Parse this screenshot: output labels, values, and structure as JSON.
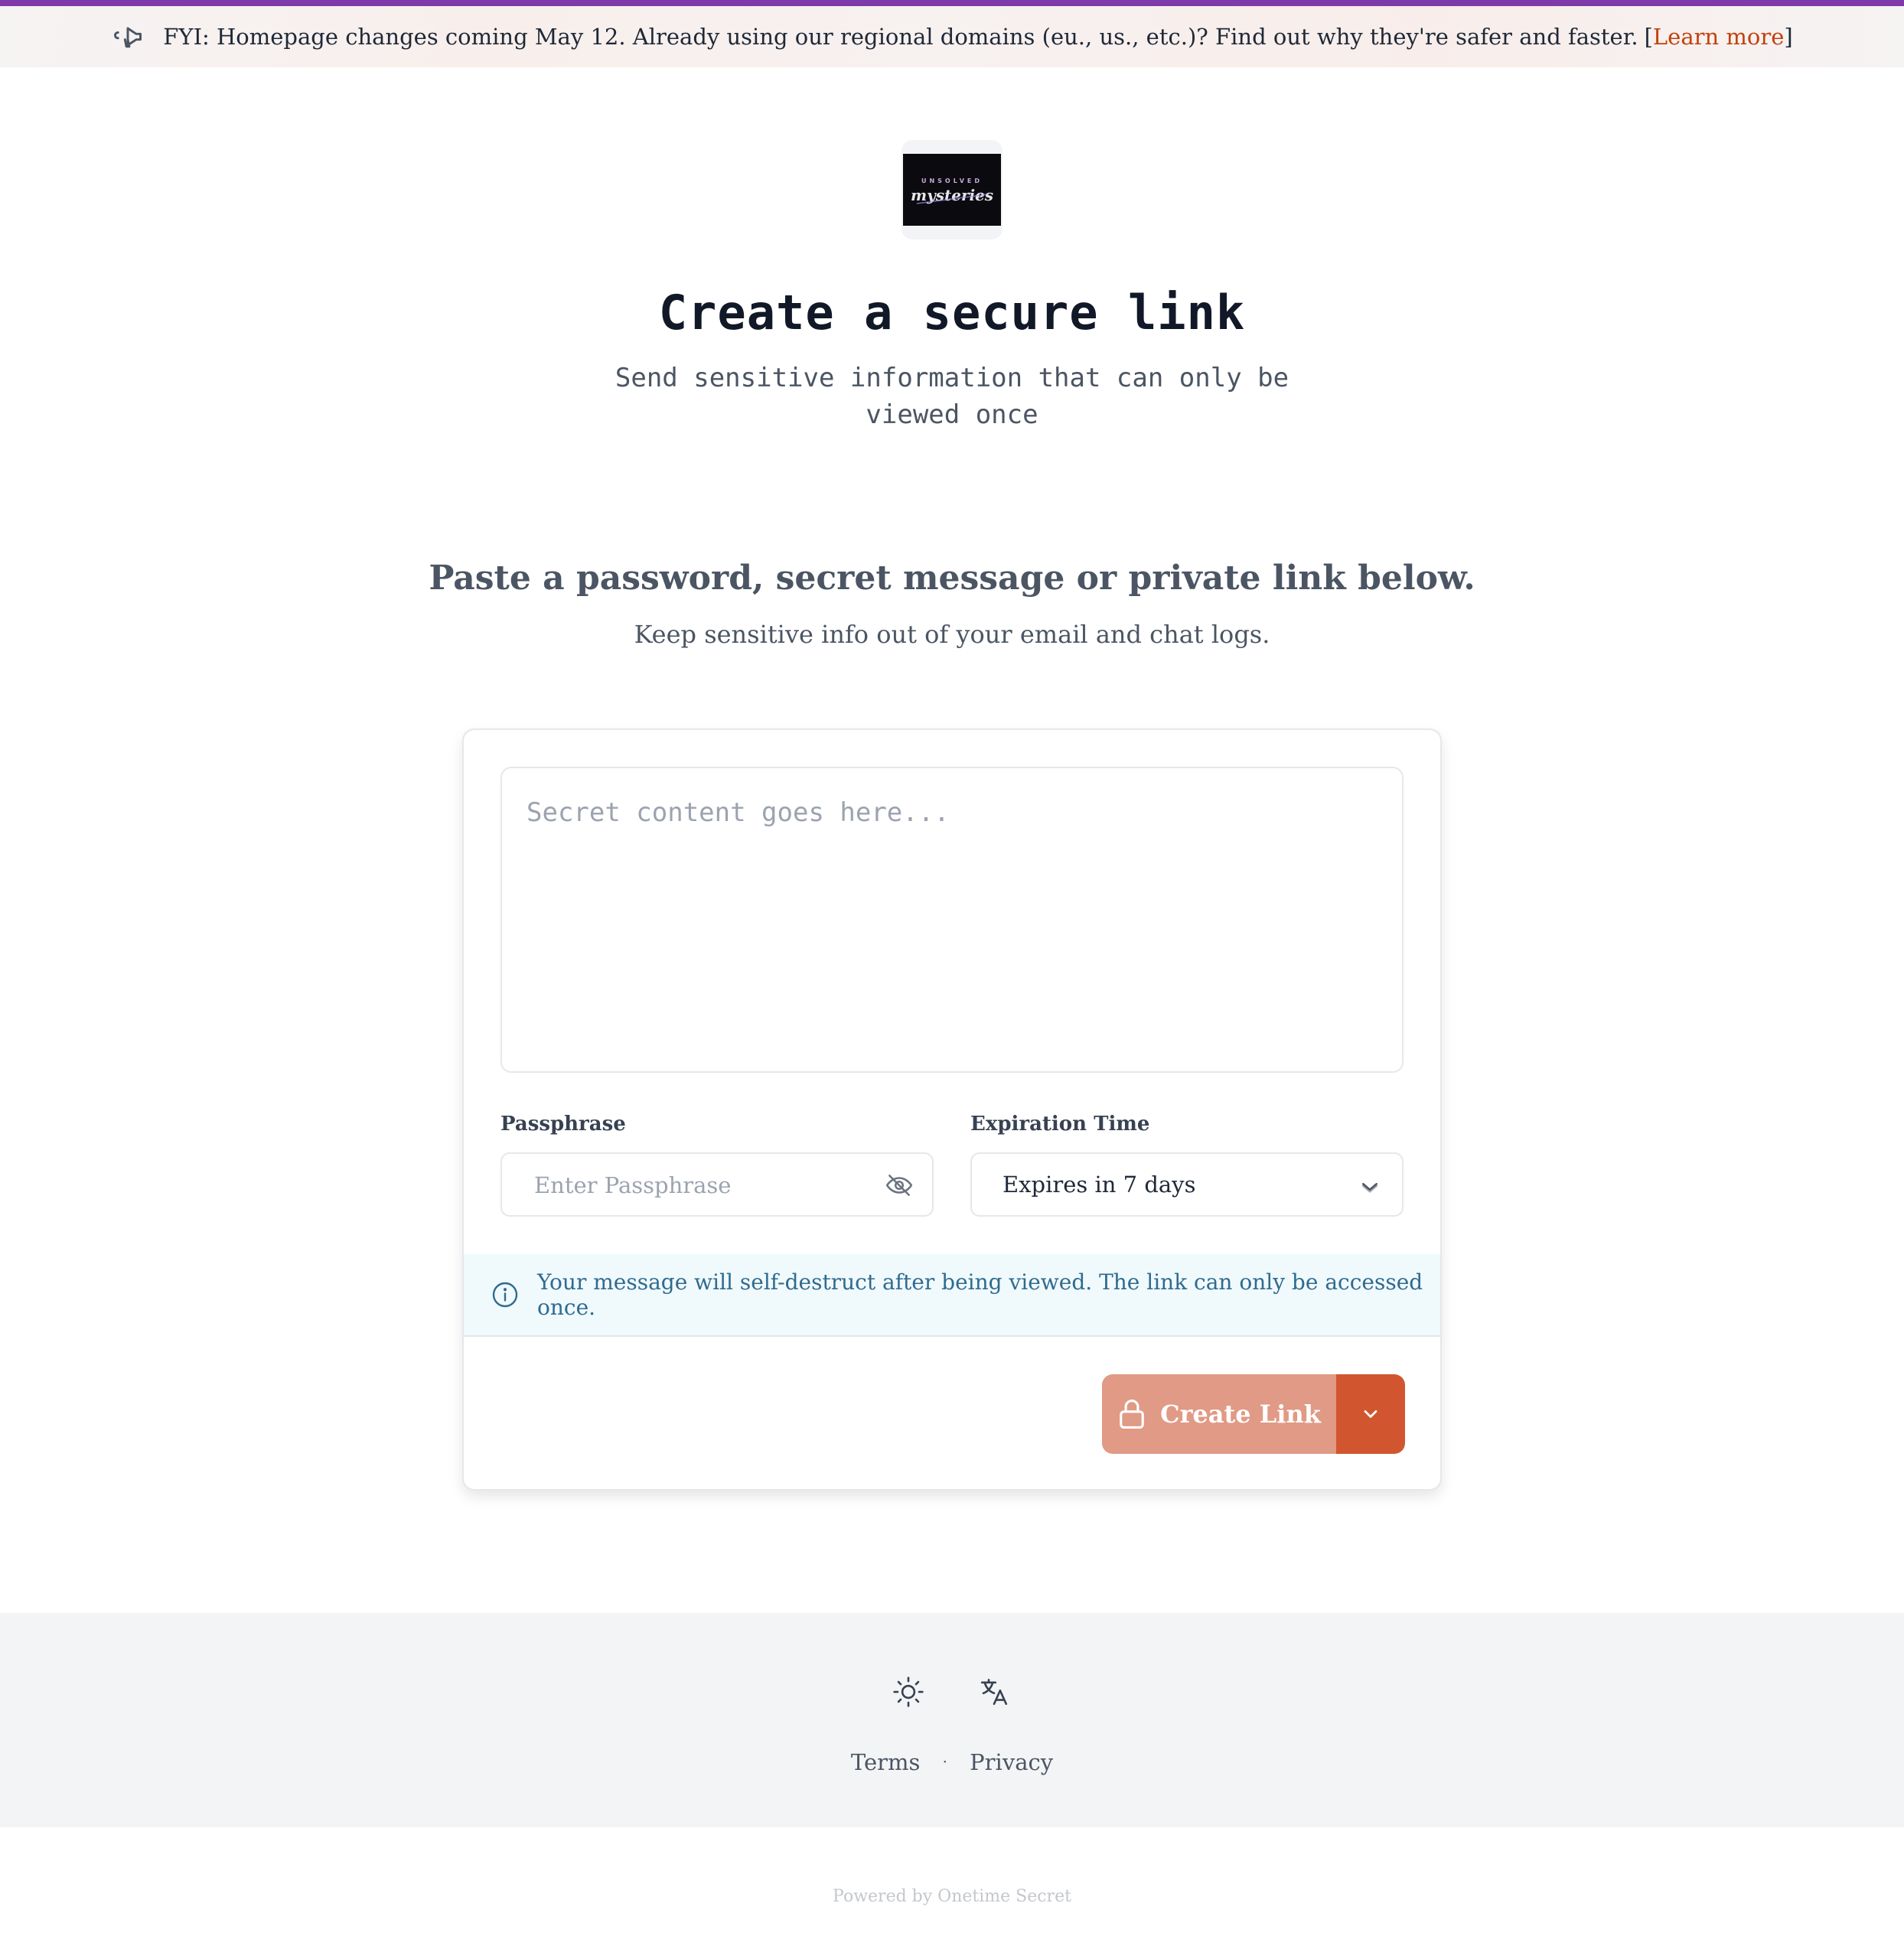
{
  "banner": {
    "icon": "megaphone-icon",
    "message": "FYI: Homepage changes coming May 12. Already using our regional domains (eu., us., etc.)? Find out why they're safer and faster.",
    "open_bracket": "[",
    "link_text": "Learn more",
    "close_bracket": "]",
    "accent_color": "#7e3aa8",
    "link_color": "#c2410c"
  },
  "logo": {
    "alt": "Unsolved Mysteries",
    "top_text": "UNSOLVED",
    "script_text": "mysteries"
  },
  "hero": {
    "title": "Create a secure link",
    "subtitle": "Send sensitive information that can only be viewed once"
  },
  "intro": {
    "heading": "Paste a password, secret message or private link below.",
    "lead": "Keep sensitive info out of your email and chat logs."
  },
  "form": {
    "secret_placeholder": "Secret content goes here...",
    "secret_value": "",
    "passphrase_label": "Passphrase",
    "passphrase_placeholder": "Enter Passphrase",
    "passphrase_value": "",
    "passphrase_toggle_icon": "eye-slash-icon",
    "expiration_label": "Expiration Time",
    "expiration_value": "Expires in 7 days",
    "notice": "Your message will self-destruct after being viewed. The link can only be accessed once.",
    "notice_icon": "info-icon",
    "create_label": "Create Link",
    "create_icon": "lock-icon",
    "more_icon": "chevron-down-icon",
    "create_color": "#e09a85",
    "more_color": "#d1562f"
  },
  "footer": {
    "theme_icon": "sun-icon",
    "language_icon": "translate-icon",
    "terms": "Terms",
    "separator": "·",
    "privacy": "Privacy",
    "powered_by": "Powered by Onetime Secret"
  }
}
